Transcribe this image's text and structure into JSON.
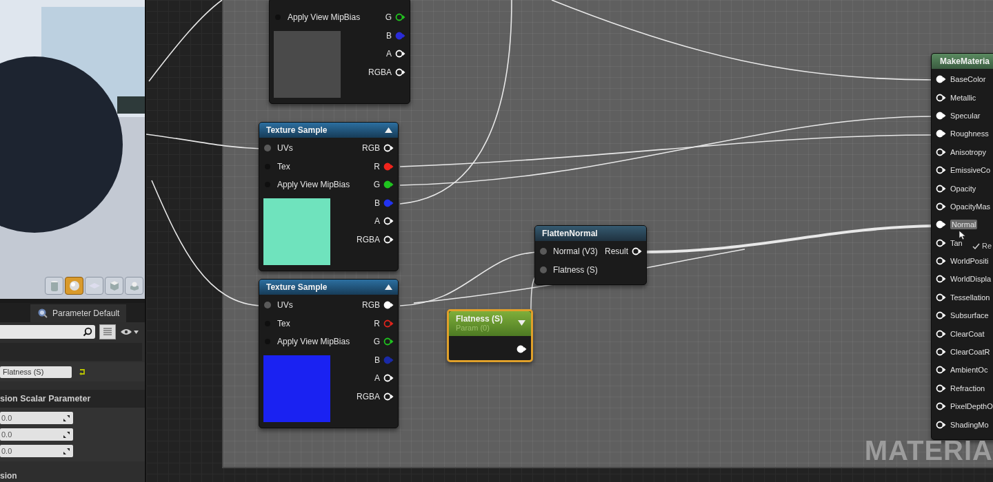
{
  "viewport": {
    "preview_buttons": [
      {
        "selected": false
      },
      {
        "selected": true
      },
      {
        "selected": false
      },
      {
        "selected": false
      },
      {
        "selected": false
      }
    ]
  },
  "details": {
    "tabs": [
      {
        "label": "Parameter Default",
        "selected": true
      }
    ],
    "name_field": {
      "value": "Flatness (S)"
    },
    "section_title": "sion Scalar Parameter",
    "value_fields": [
      {
        "value": "0.0"
      },
      {
        "value": "0.0"
      },
      {
        "value": "0.0"
      }
    ],
    "next_section_title": "sion"
  },
  "graph": {
    "nodes": [
      {
        "kind": "texture_sample",
        "inputs": [
          {
            "label": "Apply View MipBias",
            "connected": false
          }
        ],
        "outputs": [
          {
            "label": "G",
            "color": "#22c41f",
            "connected": false
          },
          {
            "label": "B",
            "color": "#2a2cd8",
            "connected": true
          },
          {
            "label": "A",
            "color": "#ffffff",
            "connected": false
          },
          {
            "label": "RGBA",
            "color": "#ffffff",
            "connected": false
          }
        ],
        "preview": {
          "color": "#4a4a4a"
        }
      },
      {
        "kind": "texture_sample",
        "title": "Texture Sample",
        "inputs": [
          {
            "label": "UVs",
            "connected": true
          },
          {
            "label": "Tex",
            "connected": false
          },
          {
            "label": "Apply View MipBias",
            "connected": false
          }
        ],
        "outputs": [
          {
            "label": "RGB",
            "color": "#ffffff",
            "connected": false
          },
          {
            "label": "R",
            "color": "#f0241c",
            "connected": true
          },
          {
            "label": "G",
            "color": "#1fc41f",
            "connected": true
          },
          {
            "label": "B",
            "color": "#2233f0",
            "connected": true
          },
          {
            "label": "A",
            "color": "#ffffff",
            "connected": false
          },
          {
            "label": "RGBA",
            "color": "#ffffff",
            "connected": false
          }
        ],
        "preview": {
          "color": "#6fe3bd"
        }
      },
      {
        "kind": "texture_sample",
        "title": "Texture Sample",
        "inputs": [
          {
            "label": "UVs",
            "connected": true
          },
          {
            "label": "Tex",
            "connected": false
          },
          {
            "label": "Apply View MipBias",
            "connected": false
          }
        ],
        "outputs": [
          {
            "label": "RGB",
            "color": "#ffffff",
            "connected": true
          },
          {
            "label": "R",
            "color": "#e0241c",
            "connected": false
          },
          {
            "label": "G",
            "color": "#1fc41f",
            "connected": false
          },
          {
            "label": "B",
            "color": "#1a2aa8",
            "connected": true
          },
          {
            "label": "A",
            "color": "#ffffff",
            "connected": false
          },
          {
            "label": "RGBA",
            "color": "#ffffff",
            "connected": false
          }
        ],
        "preview": {
          "color": "#1a22f2"
        }
      },
      {
        "kind": "function",
        "title": "FlattenNormal",
        "inputs": [
          {
            "label": "Normal (V3)",
            "connected": true
          },
          {
            "label": "Flatness (S)",
            "connected": true
          }
        ],
        "outputs": [
          {
            "label": "Result",
            "color": "#ffffff",
            "connected": false
          }
        ]
      },
      {
        "kind": "scalar_parameter",
        "title": "Flatness (S)",
        "subtitle": "Param (0)",
        "selected": true,
        "outputs": [
          {
            "color": "#ffffff",
            "connected": true
          }
        ]
      },
      {
        "kind": "make_material",
        "title": "MakeMateria",
        "tooltip": "Re",
        "inputs": [
          {
            "label": "BaseColor",
            "connected": true,
            "highlighted": false
          },
          {
            "label": "Metallic",
            "connected": false,
            "highlighted": false
          },
          {
            "label": "Specular",
            "connected": true,
            "highlighted": false
          },
          {
            "label": "Roughness",
            "connected": true,
            "highlighted": false
          },
          {
            "label": "Anisotropy",
            "connected": false,
            "highlighted": false
          },
          {
            "label": "EmissiveCo",
            "connected": false,
            "highlighted": false
          },
          {
            "label": "Opacity",
            "connected": false,
            "highlighted": false
          },
          {
            "label": "OpacityMas",
            "connected": false,
            "highlighted": false
          },
          {
            "label": "Normal",
            "connected": true,
            "highlighted": true
          },
          {
            "label": "Tan",
            "connected": false,
            "highlighted": false
          },
          {
            "label": "WorldPositi",
            "connected": false,
            "highlighted": false
          },
          {
            "label": "WorldDispla",
            "connected": false,
            "highlighted": false
          },
          {
            "label": "Tessellation",
            "connected": false,
            "highlighted": false
          },
          {
            "label": "Subsurface",
            "connected": false,
            "highlighted": false
          },
          {
            "label": "ClearCoat",
            "connected": false,
            "highlighted": false
          },
          {
            "label": "ClearCoatR",
            "connected": false,
            "highlighted": false
          },
          {
            "label": "AmbientOc",
            "connected": false,
            "highlighted": false
          },
          {
            "label": "Refraction",
            "connected": false,
            "highlighted": false
          },
          {
            "label": "PixelDepthO",
            "connected": false,
            "highlighted": false
          },
          {
            "label": "ShadingMo",
            "connected": false,
            "highlighted": false
          }
        ]
      }
    ],
    "watermark": "MATERIA"
  }
}
